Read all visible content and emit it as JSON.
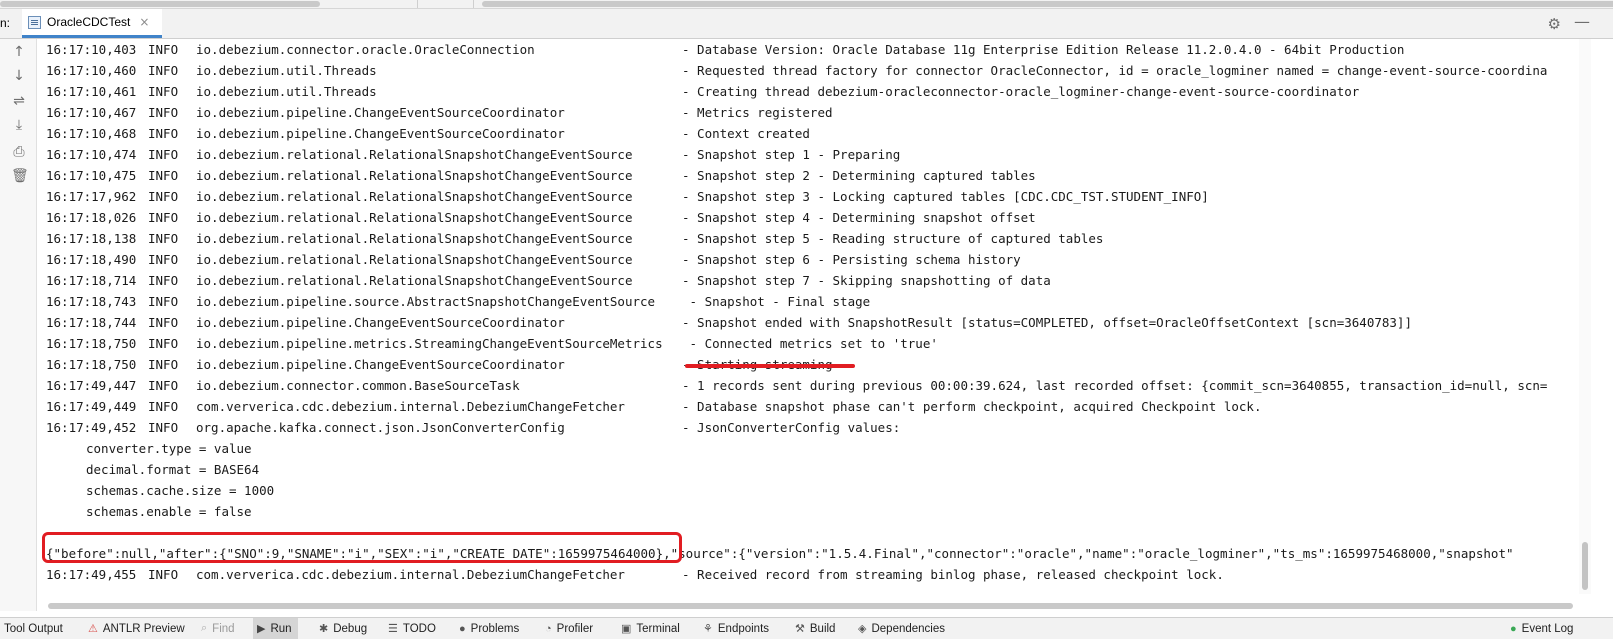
{
  "tab_bar": {
    "run_prefix": "n:",
    "tab_label": "OracleCDCTest",
    "tab_close": "×",
    "settings_icon": "gear-icon",
    "minimize_icon": "minimize-icon"
  },
  "left_toolbar": {
    "icons": [
      "arrow-up-icon",
      "arrow-down-icon",
      "soft-wrap-icon",
      "scroll-to-end-icon",
      "print-icon",
      "trash-icon"
    ]
  },
  "console": {
    "log_lines": [
      {
        "time": "16:17:10,403",
        "level": "INFO",
        "logger": "io.debezium.connector.oracle.OracleConnection",
        "msg": "- Database Version: Oracle Database 11g Enterprise Edition Release 11.2.0.4.0 - 64bit Production"
      },
      {
        "time": "16:17:10,460",
        "level": "INFO",
        "logger": "io.debezium.util.Threads",
        "msg": "- Requested thread factory for connector OracleConnector, id = oracle_logminer named = change-event-source-coordina"
      },
      {
        "time": "16:17:10,461",
        "level": "INFO",
        "logger": "io.debezium.util.Threads",
        "msg": "- Creating thread debezium-oracleconnector-oracle_logminer-change-event-source-coordinator"
      },
      {
        "time": "16:17:10,467",
        "level": "INFO",
        "logger": "io.debezium.pipeline.ChangeEventSourceCoordinator",
        "msg": "- Metrics registered"
      },
      {
        "time": "16:17:10,468",
        "level": "INFO",
        "logger": "io.debezium.pipeline.ChangeEventSourceCoordinator",
        "msg": "- Context created"
      },
      {
        "time": "16:17:10,474",
        "level": "INFO",
        "logger": "io.debezium.relational.RelationalSnapshotChangeEventSource",
        "msg": "- Snapshot step 1 - Preparing"
      },
      {
        "time": "16:17:10,475",
        "level": "INFO",
        "logger": "io.debezium.relational.RelationalSnapshotChangeEventSource",
        "msg": "- Snapshot step 2 - Determining captured tables"
      },
      {
        "time": "16:17:17,962",
        "level": "INFO",
        "logger": "io.debezium.relational.RelationalSnapshotChangeEventSource",
        "msg": "- Snapshot step 3 - Locking captured tables [CDC.CDC_TST.STUDENT_INFO]"
      },
      {
        "time": "16:17:18,026",
        "level": "INFO",
        "logger": "io.debezium.relational.RelationalSnapshotChangeEventSource",
        "msg": "- Snapshot step 4 - Determining snapshot offset"
      },
      {
        "time": "16:17:18,138",
        "level": "INFO",
        "logger": "io.debezium.relational.RelationalSnapshotChangeEventSource",
        "msg": "- Snapshot step 5 - Reading structure of captured tables"
      },
      {
        "time": "16:17:18,490",
        "level": "INFO",
        "logger": "io.debezium.relational.RelationalSnapshotChangeEventSource",
        "msg": "- Snapshot step 6 - Persisting schema history"
      },
      {
        "time": "16:17:18,714",
        "level": "INFO",
        "logger": "io.debezium.relational.RelationalSnapshotChangeEventSource",
        "msg": "- Snapshot step 7 - Skipping snapshotting of data"
      },
      {
        "time": "16:17:18,743",
        "level": "INFO",
        "logger": "io.debezium.pipeline.source.AbstractSnapshotChangeEventSource",
        "msg": " - Snapshot - Final stage"
      },
      {
        "time": "16:17:18,744",
        "level": "INFO",
        "logger": "io.debezium.pipeline.ChangeEventSourceCoordinator",
        "msg": "- Snapshot ended with SnapshotResult [status=COMPLETED, offset=OracleOffsetContext [scn=3640783]]"
      },
      {
        "time": "16:17:18,750",
        "level": "INFO",
        "logger": "io.debezium.pipeline.metrics.StreamingChangeEventSourceMetrics",
        "msg": " - Connected metrics set to 'true'"
      },
      {
        "time": "16:17:18,750",
        "level": "INFO",
        "logger": "io.debezium.pipeline.ChangeEventSourceCoordinator",
        "msg": "- Starting streaming"
      },
      {
        "time": "16:17:49,447",
        "level": "INFO",
        "logger": "io.debezium.connector.common.BaseSourceTask",
        "msg": "- 1 records sent during previous 00:00:39.624, last recorded offset: {commit_scn=3640855, transaction_id=null, scn="
      },
      {
        "time": "16:17:49,449",
        "level": "INFO",
        "logger": "com.ververica.cdc.debezium.internal.DebeziumChangeFetcher",
        "msg": "- Database snapshot phase can't perform checkpoint, acquired Checkpoint lock."
      },
      {
        "time": "16:17:49,452",
        "level": "INFO",
        "logger": "org.apache.kafka.connect.json.JsonConverterConfig",
        "msg": "- JsonConverterConfig values:"
      }
    ],
    "config_lines": [
      "converter.type = value",
      "decimal.format = BASE64",
      "schemas.cache.size = 1000",
      "schemas.enable = false"
    ],
    "json_record": "{\"before\":null,\"after\":{\"SNO\":9,\"SNAME\":\"i\",\"SEX\":\"i\",\"CREATE_DATE\":1659975464000},\"source\":{\"version\":\"1.5.4.Final\",\"connector\":\"oracle\",\"name\":\"oracle_logminer\",\"ts_ms\":1659975468000,\"snapshot\"",
    "last_line": {
      "time": "16:17:49,455",
      "level": "INFO",
      "logger": "com.ververica.cdc.debezium.internal.DebeziumChangeFetcher",
      "msg": "- Received record from streaming binlog phase, released checkpoint lock."
    }
  },
  "bottom_bar": {
    "items": [
      {
        "label": "Tool Output",
        "icon": ""
      },
      {
        "label": "ANTLR Preview",
        "icon": "antlr-icon"
      },
      {
        "label": "Find",
        "icon": "search-icon"
      },
      {
        "label": "Run",
        "icon": "play-icon"
      },
      {
        "label": "Debug",
        "icon": "bug-icon"
      },
      {
        "label": "TODO",
        "icon": "list-icon"
      },
      {
        "label": "Problems",
        "icon": "info-icon"
      },
      {
        "label": "Profiler",
        "icon": "profiler-icon"
      },
      {
        "label": "Terminal",
        "icon": "terminal-icon"
      },
      {
        "label": "Endpoints",
        "icon": "endpoints-icon"
      },
      {
        "label": "Build",
        "icon": "hammer-icon"
      },
      {
        "label": "Dependencies",
        "icon": "layers-icon"
      },
      {
        "label": "Event Log",
        "icon": "event-log-icon"
      }
    ]
  },
  "colors": {
    "highlight_red": "#e11d22",
    "tab_underline": "#4083c9",
    "event_log_green": "#3aa856"
  }
}
